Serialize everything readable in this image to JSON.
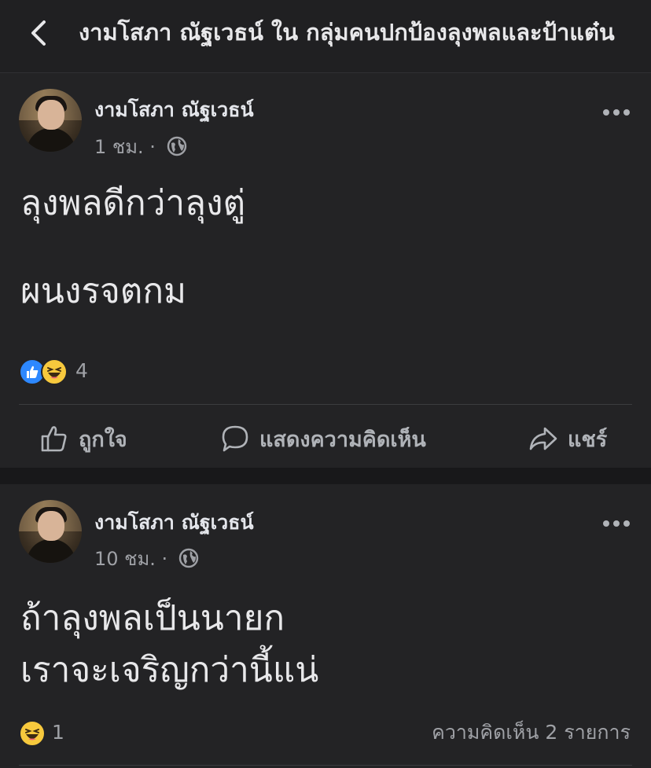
{
  "header": {
    "title": "งามโสภา ณัฐเวธน์ ใน กลุ่มคนปกป้องลุงพลและป้าแต๋น",
    "back_icon": "chevron-left-icon"
  },
  "posts": [
    {
      "author": "งามโสภา ณัฐเวธน์",
      "time": "1 ชม. ·",
      "privacy_icon": "globe-icon",
      "text": "ลุงพลดีกว่าลุงตู่\n\nผนงรจตกม",
      "reactions": [
        "like",
        "haha"
      ],
      "reaction_count": "4",
      "actions": {
        "like": "ถูกใจ",
        "comment": "แสดงความคิดเห็น",
        "share": "แชร์"
      }
    },
    {
      "author": "งามโสภา ณัฐเวธน์",
      "time": "10 ชม. ·",
      "privacy_icon": "globe-icon",
      "text": "ถ้าลุงพลเป็นนายก\nเราจะเจริญกว่านี้แน่",
      "reactions": [
        "haha"
      ],
      "reaction_count": "1",
      "comment_count": "ความคิดเห็น 2 รายการ"
    }
  ],
  "colors": {
    "background": "#18181a",
    "card": "#232325",
    "like_blue": "#2d88ff",
    "haha_yellow": "#f7c93d",
    "secondary_text": "#9fa1a6"
  }
}
